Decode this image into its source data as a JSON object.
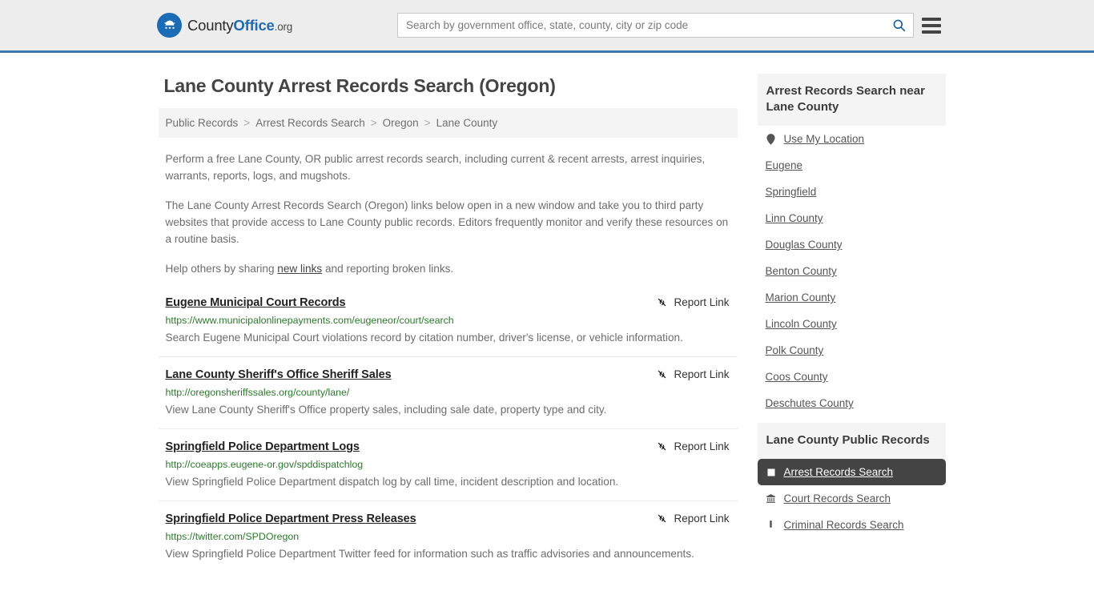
{
  "header": {
    "logo": {
      "icon": "eagle-seal-icon",
      "text_1": "County",
      "text_2": "Office",
      "text_3": ".org"
    },
    "search": {
      "placeholder": "Search by government office, state, county, city or zip code",
      "value": "",
      "search_icon": "search-icon"
    },
    "menu_icon": "hamburger-menu-icon",
    "accent_color": "#3d77ab"
  },
  "page": {
    "title": "Lane County Arrest Records Search (Oregon)",
    "breadcrumb": [
      "Public Records",
      "Arrest Records Search",
      "Oregon",
      "Lane County"
    ],
    "breadcrumb_separator": ">",
    "intro": {
      "p1": "Perform a free Lane County, OR public arrest records search, including current & recent arrests, arrest inquiries, warrants, reports, logs, and mugshots.",
      "p2": "The Lane County Arrest Records Search (Oregon) links below open in a new window and take you to third party websites that provide access to Lane County public records. Editors frequently monitor and verify these resources on a routine basis.",
      "p3_before": "Help others by sharing ",
      "p3_link": "new links",
      "p3_after": " and reporting broken links."
    }
  },
  "results": {
    "report_label": "Report Link",
    "report_icon": "broken-link-icon",
    "items": [
      {
        "title": "Eugene Municipal Court Records",
        "url": "https://www.municipalonlinepayments.com/eugeneor/court/search",
        "description": "Search Eugene Municipal Court violations record by citation number, driver's license, or vehicle information."
      },
      {
        "title": "Lane County Sheriff's Office Sheriff Sales",
        "url": "http://oregonsheriffssales.org/county/lane/",
        "description": "View Lane County Sheriff's Office property sales, including sale date, property type and city."
      },
      {
        "title": "Springfield Police Department Logs",
        "url": "http://coeapps.eugene-or.gov/spddispatchlog",
        "description": "View Springfield Police Department dispatch log by call time, incident description and location."
      },
      {
        "title": "Springfield Police Department Press Releases",
        "url": "https://twitter.com/SPDOregon",
        "description": "View Springfield Police Department Twitter feed for information such as traffic advisories and announcements."
      }
    ]
  },
  "sidebar": {
    "nearby": {
      "heading": "Arrest Records Search near Lane County",
      "items": [
        {
          "label": "Use My Location",
          "icon": "map-pin-icon"
        },
        {
          "label": "Eugene",
          "icon": ""
        },
        {
          "label": "Springfield",
          "icon": ""
        },
        {
          "label": "Linn County",
          "icon": ""
        },
        {
          "label": "Douglas County",
          "icon": ""
        },
        {
          "label": "Benton County",
          "icon": ""
        },
        {
          "label": "Marion County",
          "icon": ""
        },
        {
          "label": "Lincoln County",
          "icon": ""
        },
        {
          "label": "Polk County",
          "icon": ""
        },
        {
          "label": "Coos County",
          "icon": ""
        },
        {
          "label": "Deschutes County",
          "icon": ""
        }
      ]
    },
    "public_records": {
      "heading": "Lane County Public Records",
      "active_index": 0,
      "active_color": "#444444",
      "items": [
        {
          "label": "Arrest Records Search",
          "icon": "document-icon",
          "active": true
        },
        {
          "label": "Court Records Search",
          "icon": "courthouse-icon",
          "active": false
        },
        {
          "label": "Criminal Records Search",
          "icon": "gavel-icon",
          "active": false
        }
      ]
    }
  }
}
